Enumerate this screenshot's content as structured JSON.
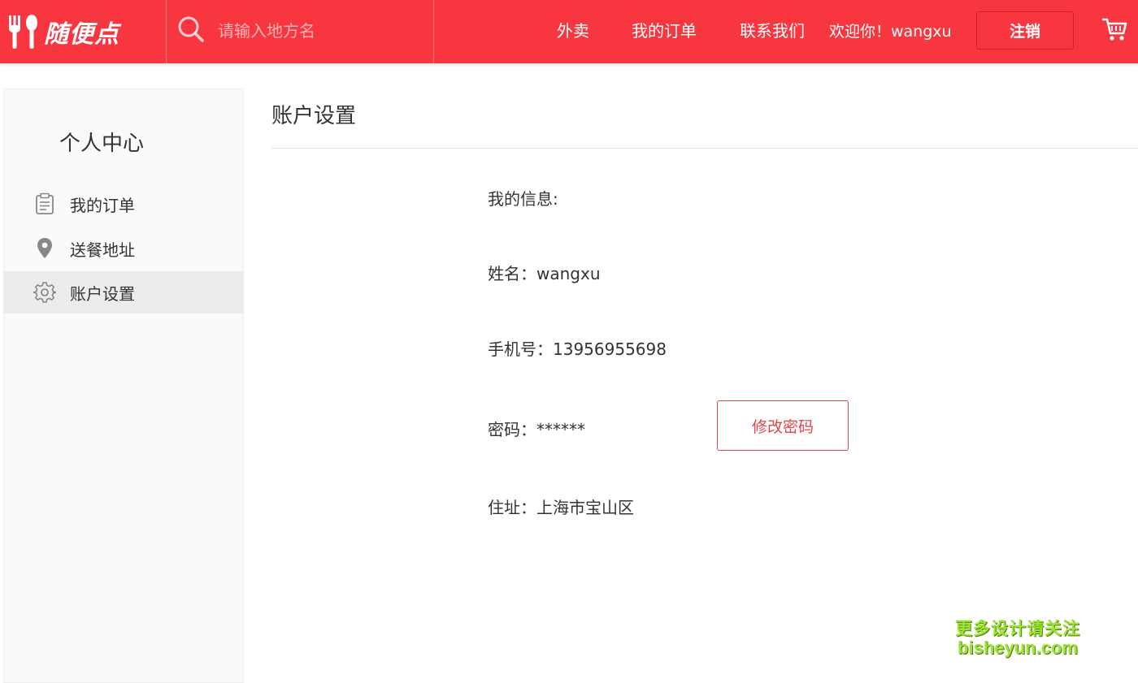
{
  "header": {
    "logo_text": "随便点",
    "search_placeholder": "请输入地方名",
    "nav": {
      "takeout": "外卖",
      "my_orders": "我的订单",
      "contact": "联系我们"
    },
    "welcome": "欢迎你！wangxu",
    "logout_label": "注销",
    "icons": {
      "logo": "fork-spoon-icon",
      "search": "search-icon",
      "cart": "cart-icon"
    }
  },
  "sidebar": {
    "title": "个人中心",
    "items": [
      {
        "label": "我的订单",
        "icon": "clipboard-icon",
        "active": false
      },
      {
        "label": "送餐地址",
        "icon": "location-pin-icon",
        "active": false
      },
      {
        "label": "账户设置",
        "icon": "gear-icon",
        "active": true
      }
    ]
  },
  "main": {
    "title": "账户设置",
    "info_heading": "我的信息:",
    "name": "姓名：wangxu",
    "phone": "手机号：13956955698",
    "password": "密码：******",
    "change_password_label": "修改密码",
    "address": "住址：上海市宝山区"
  },
  "watermark": {
    "line1": "更多设计请关注",
    "line2": "bisheyun.com"
  },
  "colors": {
    "brand_red": "#f73640",
    "button_red": "#e0444c",
    "watermark_green": "#9be531"
  }
}
